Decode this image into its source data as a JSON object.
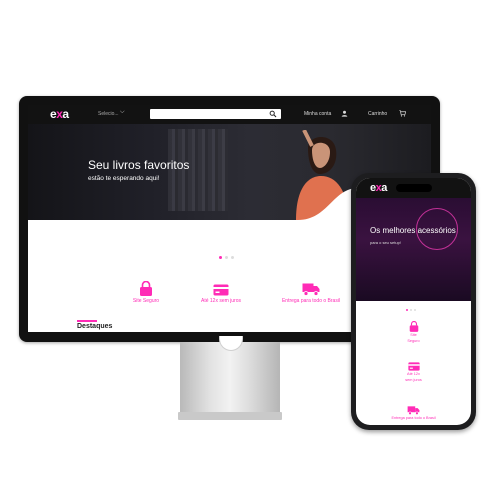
{
  "colors": {
    "accent": "#ff2bb6",
    "nav_bg": "#121212"
  },
  "brand": {
    "logo_left": "e",
    "logo_mid": "x",
    "logo_right": "a"
  },
  "desktop": {
    "nav": {
      "select_label": "Selecio...",
      "account_label": "Minha conta",
      "cart_label": "Carrinho"
    },
    "hero": {
      "title": "Seu livros favoritos",
      "subtitle": "estão te esperando aqui!"
    },
    "features": [
      {
        "label": "Site Seguro",
        "icon": "lock-icon"
      },
      {
        "label": "Até 12x sem juros",
        "icon": "credit-card-icon"
      },
      {
        "label": "Entrega para todo o Brasil",
        "icon": "truck-icon"
      }
    ],
    "section_title": "Destaques"
  },
  "mobile": {
    "hero": {
      "title": "Os melhores acessórios",
      "subtitle": "para o seu setup!"
    },
    "features": [
      {
        "label_line1": "Site",
        "label_line2": "Seguro",
        "icon": "lock-icon"
      },
      {
        "label_line1": "Até 12x",
        "label_line2": "sem juros",
        "icon": "credit-card-icon"
      },
      {
        "label_line1": "Entrega para todo o Brasil",
        "label_line2": "",
        "icon": "truck-icon"
      }
    ]
  }
}
